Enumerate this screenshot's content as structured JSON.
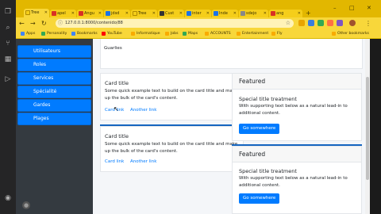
{
  "tabs": [
    {
      "label": "Tree",
      "color": "#f5ce1a"
    },
    {
      "label": "apel",
      "color": "#d93025"
    },
    {
      "label": "Angu",
      "color": "#d93025"
    },
    {
      "label": "jdsd",
      "color": "#1a73e8"
    },
    {
      "label": "Tree",
      "color": "#f5ce1a"
    },
    {
      "label": "Cust",
      "color": "#333333"
    },
    {
      "label": "inter",
      "color": "#1a73e8"
    },
    {
      "label": "Inde",
      "color": "#1a73e8"
    },
    {
      "label": "sdejo",
      "color": "#888888"
    },
    {
      "label": "ang",
      "color": "#d93025"
    }
  ],
  "browser": {
    "url": "127.0.0.1:8000/contenido/88",
    "new_tab": "+",
    "minimize": "–",
    "maximize": "□",
    "close": "✕"
  },
  "bookmarks": [
    {
      "label": "Apps",
      "color": "#4285f4"
    },
    {
      "label": "Personality",
      "color": "#34a853"
    },
    {
      "label": "Bookmarks",
      "color": "#4285f4"
    },
    {
      "label": "YouTube",
      "color": "#ff0000"
    },
    {
      "label": "Informatique",
      "color": "#f9ab00"
    },
    {
      "label": "Jobs",
      "color": "#f9ab00"
    },
    {
      "label": "Maps",
      "color": "#34a853"
    },
    {
      "label": "ACCOUNTS",
      "color": "#f9ab00"
    },
    {
      "label": "Entertainment",
      "color": "#f9ab00"
    },
    {
      "label": "Fly",
      "color": "#f9ab00"
    },
    {
      "label": "Other bookmarks",
      "color": "#f9ab00"
    }
  ],
  "sidebar": {
    "items": [
      "Utilisateurs",
      "Roles",
      "Services",
      "Spécialité",
      "Gardes",
      "Plages"
    ]
  },
  "top_card": {
    "text": "Guarlies"
  },
  "cards": [
    {
      "title": "Card title",
      "text": "Some quick example text to build on the card title and make up the bulk of the card's content.",
      "link1": "Card link",
      "link2": "Another link"
    },
    {
      "title": "Card title",
      "text": "Some quick example text to build on the card title and make up the bulk of the card's content.",
      "link1": "Card link",
      "link2": "Another link"
    }
  ],
  "featured": [
    {
      "header": "Featured",
      "title": "Special title treatment",
      "text": "With supporting text below as a natural lead-in to additional content.",
      "button": "Go somewhere"
    },
    {
      "header": "Featured",
      "title": "Special title treatment",
      "text": "With supporting text below as a natural lead-in to additional content.",
      "button": "Go somewhere"
    }
  ],
  "colors": {
    "primary": "#007bff",
    "sidebar": "#343a40",
    "chrome": "#f8d73a"
  }
}
